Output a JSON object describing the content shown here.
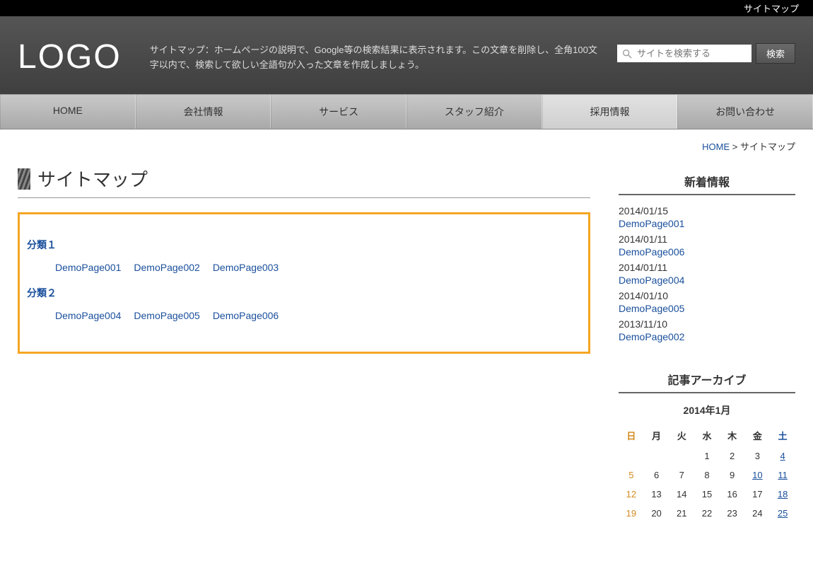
{
  "topbar": {
    "sitemap": "サイトマップ"
  },
  "header": {
    "logo": "LOGO",
    "description": "サイトマップ：ホームページの説明で、Google等の検索結果に表示されます。この文章を削除し、全角100文字以内で、検索して欲しい全語句が入った文章を作成しましょう。"
  },
  "search": {
    "placeholder": "サイトを検索する",
    "button": "検索"
  },
  "nav": {
    "items": [
      {
        "label": "HOME"
      },
      {
        "label": "会社情報"
      },
      {
        "label": "サービス"
      },
      {
        "label": "スタッフ紹介"
      },
      {
        "label": "採用情報"
      },
      {
        "label": "お問い合わせ"
      }
    ]
  },
  "breadcrumb": {
    "home": "HOME",
    "sep": " > ",
    "current": "サイトマップ"
  },
  "page": {
    "title": "サイトマップ"
  },
  "sitemap": {
    "cats": [
      {
        "title": "分類１",
        "links": [
          "DemoPage001",
          "DemoPage002",
          "DemoPage003"
        ]
      },
      {
        "title": "分類２",
        "links": [
          "DemoPage004",
          "DemoPage005",
          "DemoPage006"
        ]
      }
    ]
  },
  "sidebar": {
    "news_title": "新着情報",
    "news": [
      {
        "date": "2014/01/15",
        "link": "DemoPage001"
      },
      {
        "date": "2014/01/11",
        "link": "DemoPage006"
      },
      {
        "date": "2014/01/11",
        "link": "DemoPage004"
      },
      {
        "date": "2014/01/10",
        "link": "DemoPage005"
      },
      {
        "date": "2013/11/10",
        "link": "DemoPage002"
      }
    ],
    "archive_title": "記事アーカイブ",
    "calendar": {
      "month_label": "2014年1月",
      "dow": [
        "日",
        "月",
        "火",
        "水",
        "木",
        "金",
        "土"
      ],
      "linked_days": [
        4,
        10,
        11,
        18,
        25
      ],
      "holiday_days": [
        5,
        12,
        19
      ]
    }
  }
}
